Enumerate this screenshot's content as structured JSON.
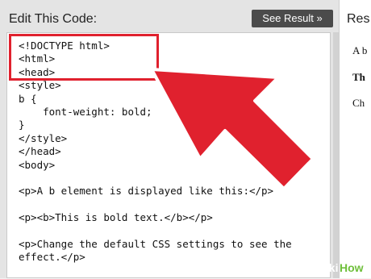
{
  "editor": {
    "title": "Edit This Code:",
    "see_result_label": "See Result »",
    "code_lines": [
      "<!DOCTYPE html>",
      "<html>",
      "<head>",
      "<style>",
      "b {",
      "    font-weight: bold;",
      "}",
      "</style>",
      "</head>",
      "<body>",
      "",
      "<p>A b element is displayed like this:</p>",
      "",
      "<p><b>This is bold text.</b></p>",
      "",
      "<p>Change the default CSS settings to see the",
      "effect.</p>",
      ""
    ]
  },
  "result": {
    "title": "Res",
    "lines": [
      "A b",
      "Th",
      "Ch"
    ]
  },
  "annotation": {
    "highlight_color": "#e0212e",
    "arrow_color": "#e0212e"
  },
  "watermark": {
    "text_part1": "wiki",
    "text_part2": "How"
  }
}
